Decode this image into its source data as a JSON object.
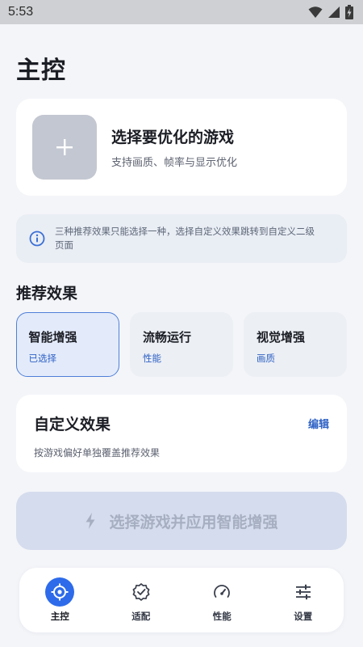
{
  "status_bar": {
    "time": "5:53"
  },
  "page": {
    "title": "主控"
  },
  "game_select": {
    "title": "选择要优化的游戏",
    "subtitle": "支持画质、帧率与显示优化"
  },
  "info": {
    "line1": "三种推荐效果只能选择一种，选择自定义效果跳转到自定义二级",
    "line2": "页面"
  },
  "presets": {
    "section_title": "推荐效果",
    "items": [
      {
        "title": "智能增强",
        "subtitle": "已选择",
        "selected": true
      },
      {
        "title": "流畅运行",
        "subtitle": "性能",
        "selected": false
      },
      {
        "title": "视觉增强",
        "subtitle": "画质",
        "selected": false
      }
    ]
  },
  "custom": {
    "title": "自定义效果",
    "edit_label": "编辑",
    "subtitle": "按游戏偏好单独覆盖推荐效果"
  },
  "apply": {
    "label": "选择游戏并应用智能增强",
    "icon": "lightning-icon"
  },
  "nav": {
    "items": [
      {
        "label": "主控",
        "icon": "target-icon",
        "active": true
      },
      {
        "label": "适配",
        "icon": "badge-check-icon",
        "active": false
      },
      {
        "label": "性能",
        "icon": "speedometer-icon",
        "active": false
      },
      {
        "label": "设置",
        "icon": "sliders-icon",
        "active": false
      }
    ]
  },
  "colors": {
    "accent": "#2d6bea",
    "accent_text": "#2f62c5",
    "background": "#f4f5f9",
    "card": "#ffffff",
    "disabled_button": "#d5dced"
  }
}
